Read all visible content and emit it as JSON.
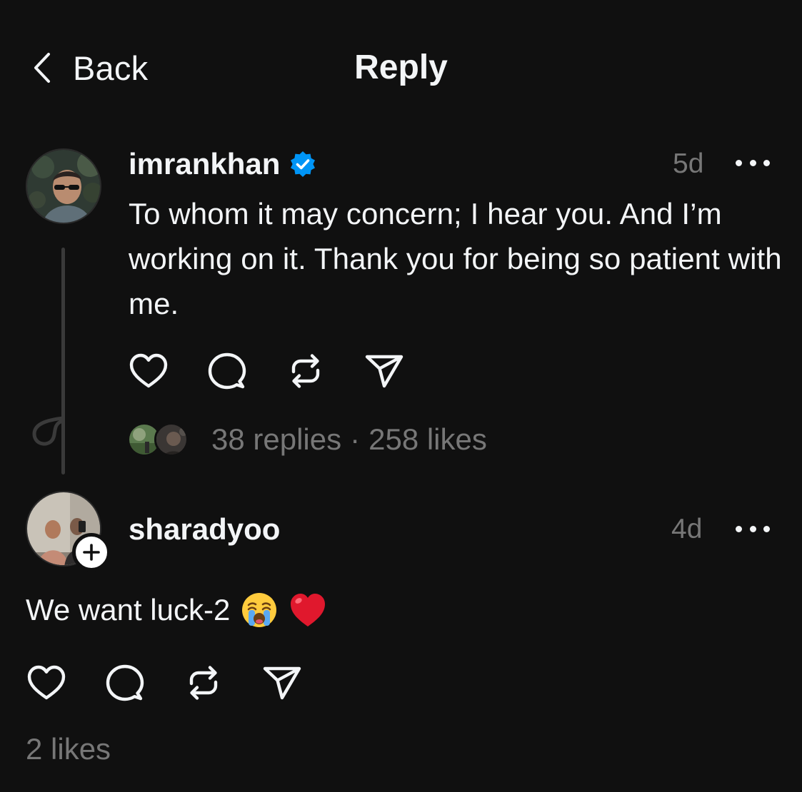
{
  "header": {
    "back_label": "Back",
    "title": "Reply"
  },
  "post": {
    "username": "imrankhan",
    "verified": true,
    "timestamp": "5d",
    "text": "To whom it may concern; I hear you. And I’m working on it. Thank you for being so patient with me.",
    "replies_label": "38 replies",
    "separator": "·",
    "likes_label": "258 likes"
  },
  "reply": {
    "username": "sharadyoo",
    "timestamp": "4d",
    "text": "We want luck-2",
    "emojis": [
      "loudly-crying-face",
      "red-heart"
    ],
    "likes_label": "2 likes"
  },
  "colors": {
    "background": "#101010",
    "primary_text": "#f3f5f7",
    "secondary_text": "#777777",
    "verified_blue": "#0095f6",
    "thread_line": "#3a3a3a"
  },
  "icons": {
    "actions": [
      "heart-icon",
      "comment-icon",
      "repost-icon",
      "share-icon"
    ],
    "back": "chevron-left-icon",
    "more": "more-horizontal-icon",
    "follow": "plus-icon"
  }
}
